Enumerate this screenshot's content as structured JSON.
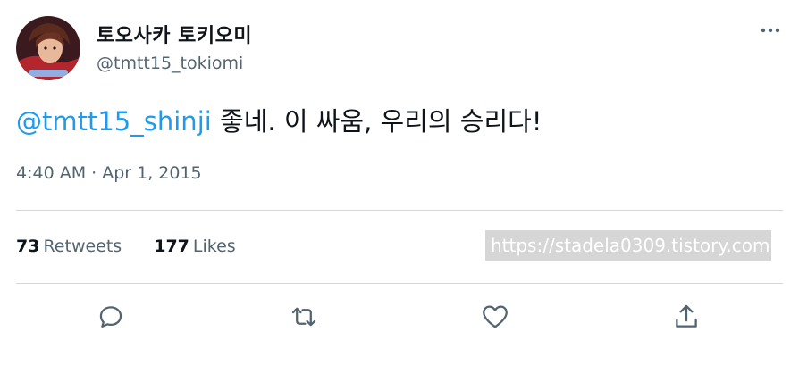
{
  "tweet": {
    "author": {
      "display_name": "토오사카 토키오미",
      "handle": "@tmtt15_tokiomi",
      "avatar_icon": "avatar-portrait"
    },
    "text": {
      "mention": "@tmtt15_shinji",
      "body": " 좋네. 이 싸움, 우리의 승리다!"
    },
    "timestamp": "4:40 AM · Apr 1, 2015",
    "stats": {
      "retweets_count": "73",
      "retweets_label": "Retweets",
      "likes_count": "177",
      "likes_label": "Likes"
    },
    "actions": {
      "reply_icon": "reply-icon",
      "retweet_icon": "retweet-icon",
      "like_icon": "heart-icon",
      "share_icon": "share-icon",
      "more_icon": "more-icon"
    }
  },
  "watermark": "https://stadela0309.tistory.com",
  "colors": {
    "accent": "#1d9bf0",
    "text": "#0f1419",
    "secondary": "#536471",
    "divider": "#cfd9de"
  }
}
